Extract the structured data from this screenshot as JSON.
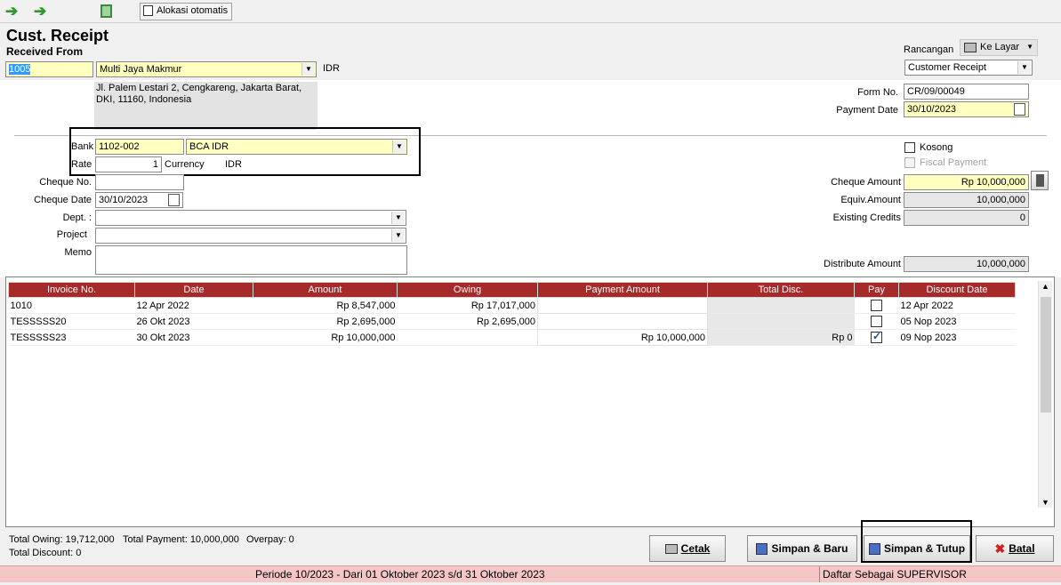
{
  "toolbar": {
    "auto_alloc_label": "Alokasi otomatis"
  },
  "header": {
    "title": "Cust. Receipt",
    "received_from_label": "Received From"
  },
  "customer": {
    "id": "1005",
    "name": "Multi Jaya Makmur",
    "currency": "IDR",
    "address": "Jl. Palem Lestari 2, Cengkareng, Jakarta Barat, DKI, 11160, Indonesia"
  },
  "rancangan": {
    "label": "Rancangan",
    "output": "Ke Layar",
    "template": "Customer Receipt"
  },
  "form": {
    "form_no_label": "Form No.",
    "form_no": "CR/09/00049",
    "payment_date_label": "Payment Date",
    "payment_date": "30/10/2023"
  },
  "bank": {
    "label": "Bank",
    "code": "1102-002",
    "name": "BCA IDR",
    "rate_label": "Rate",
    "rate": "1",
    "currency_label": "Currency",
    "currency": "IDR"
  },
  "cheque": {
    "no_label": "Cheque No.",
    "no": "",
    "date_label": "Cheque Date",
    "date": "30/10/2023"
  },
  "dept": {
    "label": "Dept. :",
    "value": ""
  },
  "project": {
    "label": "Project",
    "value": ""
  },
  "memo": {
    "label": "Memo",
    "value": ""
  },
  "options": {
    "kosong_label": "Kosong",
    "fiscal_label": "Fiscal Payment"
  },
  "amounts": {
    "cheque_amount_label": "Cheque Amount",
    "cheque_amount": "Rp 10,000,000",
    "equiv_label": "Equiv.Amount",
    "equiv": "10,000,000",
    "existing_label": "Existing Credits",
    "existing": "0",
    "distribute_label": "Distribute Amount",
    "distribute": "10,000,000"
  },
  "table": {
    "headers": [
      "Invoice No.",
      "Date",
      "Amount",
      "Owing",
      "Payment Amount",
      "Total Disc.",
      "Pay",
      "Discount Date"
    ],
    "rows": [
      {
        "invoice": "1010",
        "date": "12 Apr 2022",
        "amount": "Rp 8,547,000",
        "owing": "Rp 17,017,000",
        "payment": "",
        "disc": "",
        "pay": false,
        "disc_date": "12 Apr 2022"
      },
      {
        "invoice": "TESSSSS20",
        "date": "26 Okt 2023",
        "amount": "Rp 2,695,000",
        "owing": "Rp 2,695,000",
        "payment": "",
        "disc": "",
        "pay": false,
        "disc_date": "05 Nop 2023"
      },
      {
        "invoice": "TESSSSS23",
        "date": "30 Okt 2023",
        "amount": "Rp 10,000,000",
        "owing": "",
        "payment": "Rp 10,000,000",
        "disc": "Rp 0",
        "pay": true,
        "disc_date": "09 Nop 2023"
      }
    ]
  },
  "totals": {
    "owing": "Total Owing: 19,712,000",
    "payment": "Total Payment: 10,000,000",
    "overpay": "Overpay: 0",
    "discount": "Total Discount: 0"
  },
  "buttons": {
    "print": "Cetak",
    "save_new": "Simpan & Baru",
    "save_close": "Simpan & Tutup",
    "cancel": "Batal"
  },
  "status": {
    "period": "Periode 10/2023 - Dari 01 Oktober 2023 s/d 31 Oktober 2023",
    "user": "Daftar Sebagai SUPERVISOR"
  },
  "colors": {
    "header_red": "#a52a2a",
    "field_yellow": "#ffffc0",
    "status_pink": "#f4c6c6"
  }
}
